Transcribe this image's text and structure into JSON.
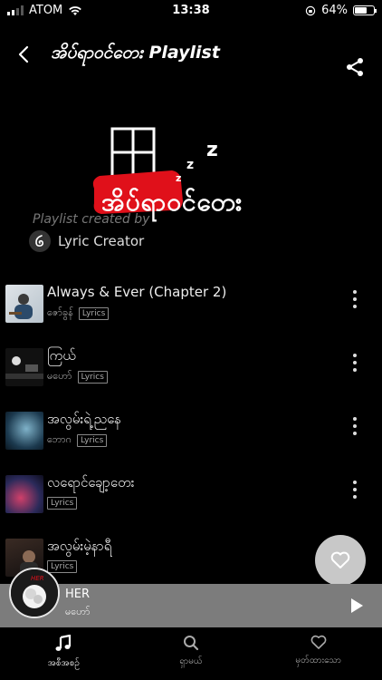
{
  "status": {
    "carrier": "ATOM",
    "time": "13:38",
    "battery": "64%",
    "battery_level": 0.64
  },
  "header": {
    "title": "အိပ်ရာဝင်တေး Playlist"
  },
  "cover": {
    "title": "အိပ်ရာဝင်တေး",
    "z_letters": [
      "z",
      "z",
      "z"
    ],
    "created_by": "Playlist created by",
    "creator": "Lyric Creator"
  },
  "tracks": [
    {
      "title": "Always & Ever (Chapter 2)",
      "artist": "ဇော်ခွန်",
      "badge": "Lyrics"
    },
    {
      "title": "ကြယ်",
      "artist": "မဟော်",
      "badge": "Lyrics"
    },
    {
      "title": "အလွမ်းရဲ့ညနေ",
      "artist": "ဘောဂ",
      "badge": "Lyrics"
    },
    {
      "title": "လရောင်ချော့တေး",
      "artist": "",
      "badge": "Lyrics"
    },
    {
      "title": "အလွမ်းမဲ့နာရီ",
      "artist": "",
      "badge": "Lyrics"
    }
  ],
  "mini_player": {
    "title": "HER",
    "artist": "မဟော်"
  },
  "bottom_nav": [
    {
      "label": "အစီအစဉ်",
      "icon": "music-note-icon",
      "active": true
    },
    {
      "label": "ရှာမယ်",
      "icon": "search-icon",
      "active": false
    },
    {
      "label": "မှတ်ထားသော",
      "icon": "heart-icon",
      "active": false
    }
  ],
  "colors": {
    "background": "#000000",
    "accent_red": "#e0101a",
    "mini_player": "#7c7c7c",
    "fab": "#c8c8c8"
  }
}
